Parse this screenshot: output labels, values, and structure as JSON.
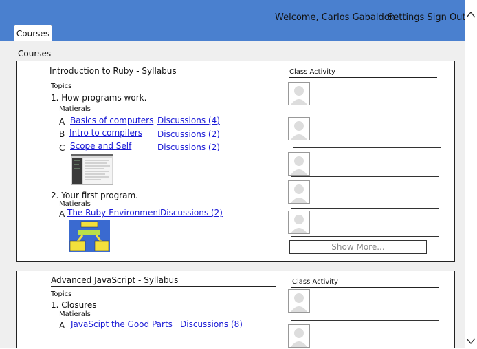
{
  "header": {
    "welcome": "Welcome, Carlos Gabaldon",
    "settings_signout": "Settings Sign Out",
    "tab_courses": "Courses",
    "bg_color": "#4a80cf"
  },
  "page": {
    "courses_heading": "Courses"
  },
  "courses": [
    {
      "title": "Introduction to Ruby - Syllabus",
      "topics_label": "Topics",
      "activity_label": "Class Activity",
      "topics": [
        {
          "title": "1. How programs work.",
          "materials_label": "Matierals",
          "items": [
            {
              "letter": "A",
              "link": "Basics of computers",
              "discussions": "Discussions (4)"
            },
            {
              "letter": "B",
              "link": "Intro to compilers",
              "discussions": "Discussions (2)"
            },
            {
              "letter": "C",
              "link": "Scope and Self",
              "discussions": "Discussions (2)"
            }
          ]
        },
        {
          "title": "2. Your first program.",
          "materials_label": "Matierals",
          "items": [
            {
              "letter": "A",
              "link": "The Ruby Environment",
              "discussions": "Discussions (2)"
            }
          ]
        }
      ],
      "show_more": "Show More..."
    },
    {
      "title": "Advanced JavaScript - Syllabus",
      "topics_label": "Topics",
      "activity_label": "Class Activity",
      "topics": [
        {
          "title": "1. Closures",
          "materials_label": "Matierals",
          "items": [
            {
              "letter": "A",
              "link": "JavaScipt the Good Parts",
              "discussions": "Discussions (8)"
            }
          ]
        }
      ]
    }
  ],
  "scrollbar": {
    "up_icon": "chevron-up-icon",
    "down_icon": "chevron-down-icon"
  }
}
